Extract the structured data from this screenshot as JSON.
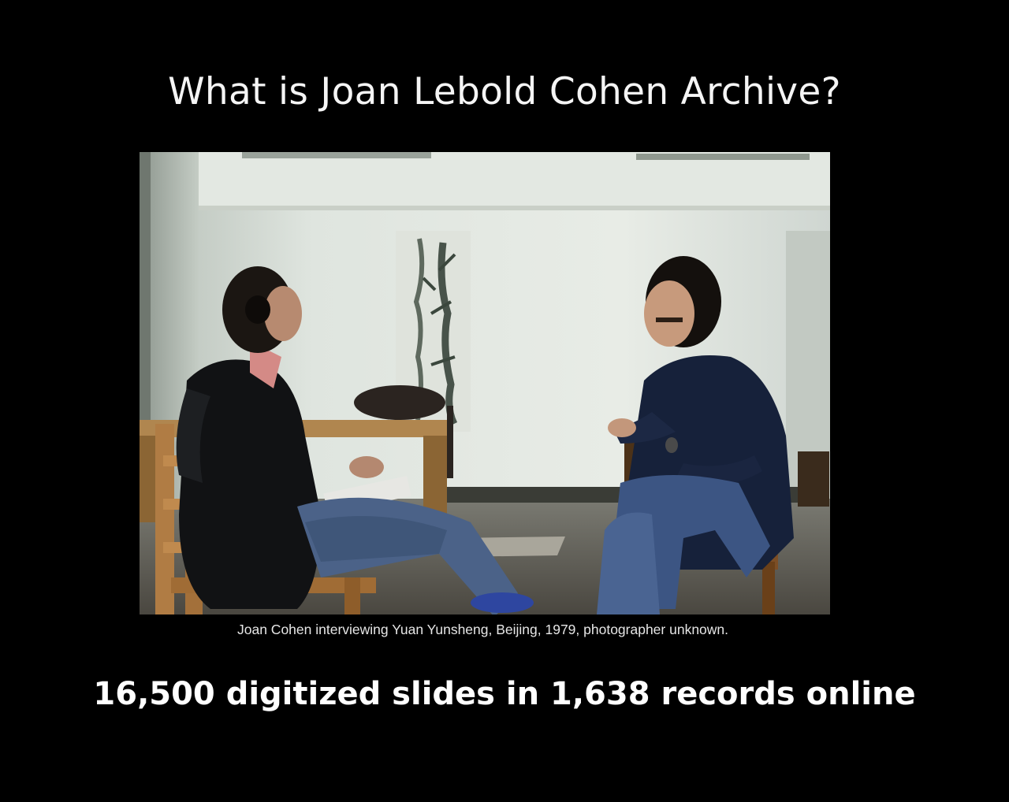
{
  "slide": {
    "title": "What is Joan Lebold Cohen Archive?",
    "photo": {
      "icon": "photograph-image",
      "caption": "Joan Cohen interviewing Yuan Yunsheng, Beijing, 1979, photographer unknown."
    },
    "statement": "16,500 digitized slides in 1,638 records online"
  },
  "colors": {
    "background": "#000000",
    "title_text": "#f5f5f5",
    "caption_text": "#e6e6e6",
    "statement_text": "#ffffff"
  }
}
